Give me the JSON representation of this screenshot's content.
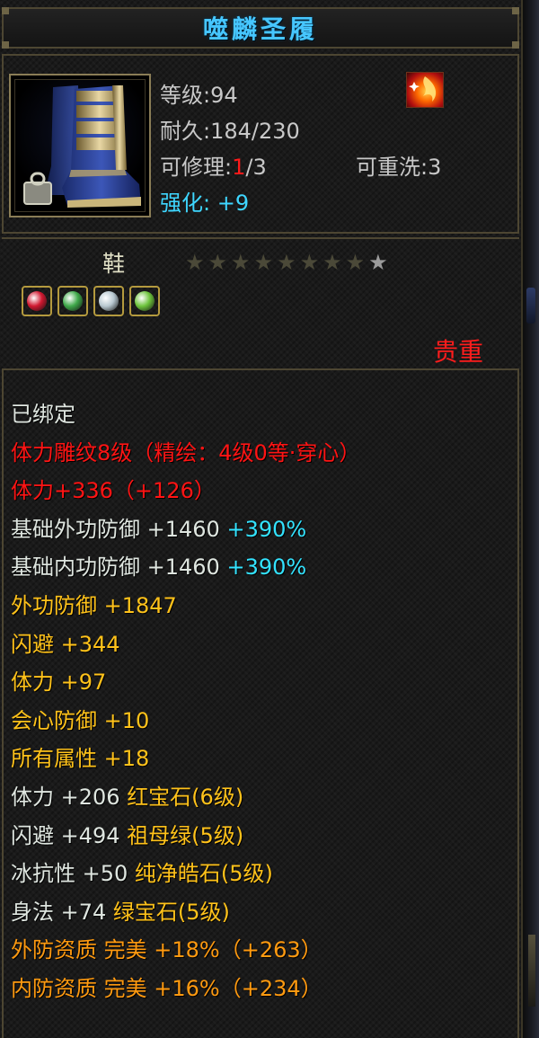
{
  "item": {
    "name": "噬麟圣履",
    "type": "鞋",
    "rarity": "贵重",
    "stars_total": 9,
    "stars_lit": 8
  },
  "stats": {
    "level_label": "等级",
    "level_sep": ":",
    "level": "94",
    "durability_label": "耐久",
    "durability_sep": ":",
    "durability": "184/230",
    "repair_label": "可修理",
    "repair_sep": ":",
    "repair_current": "1",
    "repair_rest": "/3",
    "rewash_label": "可重洗",
    "rewash_sep": ":",
    "rewash": "3",
    "enhance_label": "强化",
    "enhance_sep": ":",
    "enhance": " +9"
  },
  "gems": [
    {
      "icon": "ruby-gem-icon",
      "color": "#d01830"
    },
    {
      "icon": "emerald-gem-icon",
      "color": "#3fa84a"
    },
    {
      "icon": "diamond-gem-icon",
      "color": "#b8c8d0"
    },
    {
      "icon": "green-gem-icon",
      "color": "#6dc43c"
    }
  ],
  "attributes": [
    {
      "parts": [
        {
          "t": "已绑定",
          "c": "white"
        }
      ]
    },
    {
      "parts": [
        {
          "t": "体力雕纹8级（精绘：4级0等·穿心）",
          "c": "red"
        }
      ]
    },
    {
      "parts": [
        {
          "t": "体力+336（+126）",
          "c": "red"
        }
      ]
    },
    {
      "parts": [
        {
          "t": "基础外功防御 +1460 ",
          "c": "white"
        },
        {
          "t": "+390%",
          "c": "cyan"
        }
      ]
    },
    {
      "parts": [
        {
          "t": "基础内功防御 +1460 ",
          "c": "white"
        },
        {
          "t": "+390%",
          "c": "cyan"
        }
      ]
    },
    {
      "parts": [
        {
          "t": "外功防御 +1847",
          "c": "gold"
        }
      ]
    },
    {
      "parts": [
        {
          "t": "闪避 +344",
          "c": "gold"
        }
      ]
    },
    {
      "parts": [
        {
          "t": "体力 +97",
          "c": "gold"
        }
      ]
    },
    {
      "parts": [
        {
          "t": "会心防御 +10",
          "c": "gold"
        }
      ]
    },
    {
      "parts": [
        {
          "t": "所有属性 +18",
          "c": "gold"
        }
      ]
    },
    {
      "parts": [
        {
          "t": "体力 +206 ",
          "c": "white"
        },
        {
          "t": "红宝石(6级)",
          "c": "gold"
        }
      ]
    },
    {
      "parts": [
        {
          "t": "闪避 +494 ",
          "c": "white"
        },
        {
          "t": "祖母绿(5级)",
          "c": "gold"
        }
      ]
    },
    {
      "parts": [
        {
          "t": "冰抗性 +50 ",
          "c": "white"
        },
        {
          "t": "纯净皓石(5级)",
          "c": "gold"
        }
      ]
    },
    {
      "parts": [
        {
          "t": "身法 +74 ",
          "c": "white"
        },
        {
          "t": "绿宝石(5级)",
          "c": "gold"
        }
      ]
    },
    {
      "parts": [
        {
          "t": "外防资质  完美 +18%（+263）",
          "c": "orange"
        }
      ]
    },
    {
      "parts": [
        {
          "t": "内防资质  完美 +16%（+234）",
          "c": "orange"
        }
      ]
    }
  ]
}
